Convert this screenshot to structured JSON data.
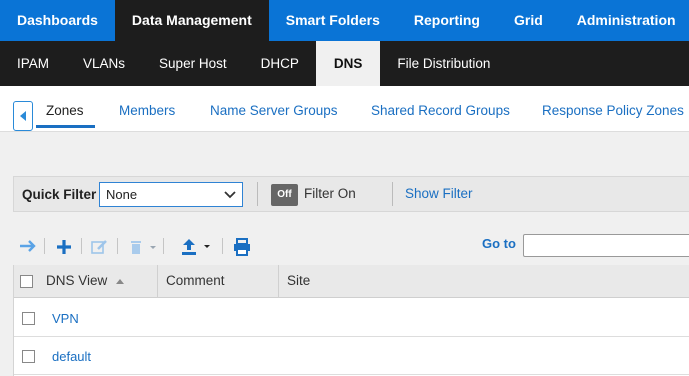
{
  "top_nav": {
    "items": [
      "Dashboards",
      "Data Management",
      "Smart Folders",
      "Reporting",
      "Grid",
      "Administration"
    ],
    "active": "Data Management"
  },
  "sub_nav": {
    "items": [
      "IPAM",
      "VLANs",
      "Super Host",
      "DHCP",
      "DNS",
      "File Distribution"
    ],
    "active": "DNS"
  },
  "tabs": {
    "items": [
      "Zones",
      "Members",
      "Name Server Groups",
      "Shared Record Groups",
      "Response Policy Zones"
    ],
    "active": "Zones"
  },
  "quick_filter": {
    "label": "Quick Filter",
    "selected": "None",
    "toggle_state": "Off",
    "toggle_label": "Filter On",
    "show_filter": "Show Filter"
  },
  "toolbar": {
    "goto_label": "Go to",
    "goto_value": ""
  },
  "grid": {
    "columns": [
      "DNS View",
      "Comment",
      "Site"
    ],
    "sorted_column": "DNS View",
    "rows": [
      {
        "dns_view": "VPN",
        "comment": "",
        "site": ""
      },
      {
        "dns_view": "default",
        "comment": "",
        "site": ""
      }
    ]
  },
  "colors": {
    "accent": "#0a74d6",
    "nav_dark": "#1d1d1d",
    "link": "#1a6fc2"
  }
}
